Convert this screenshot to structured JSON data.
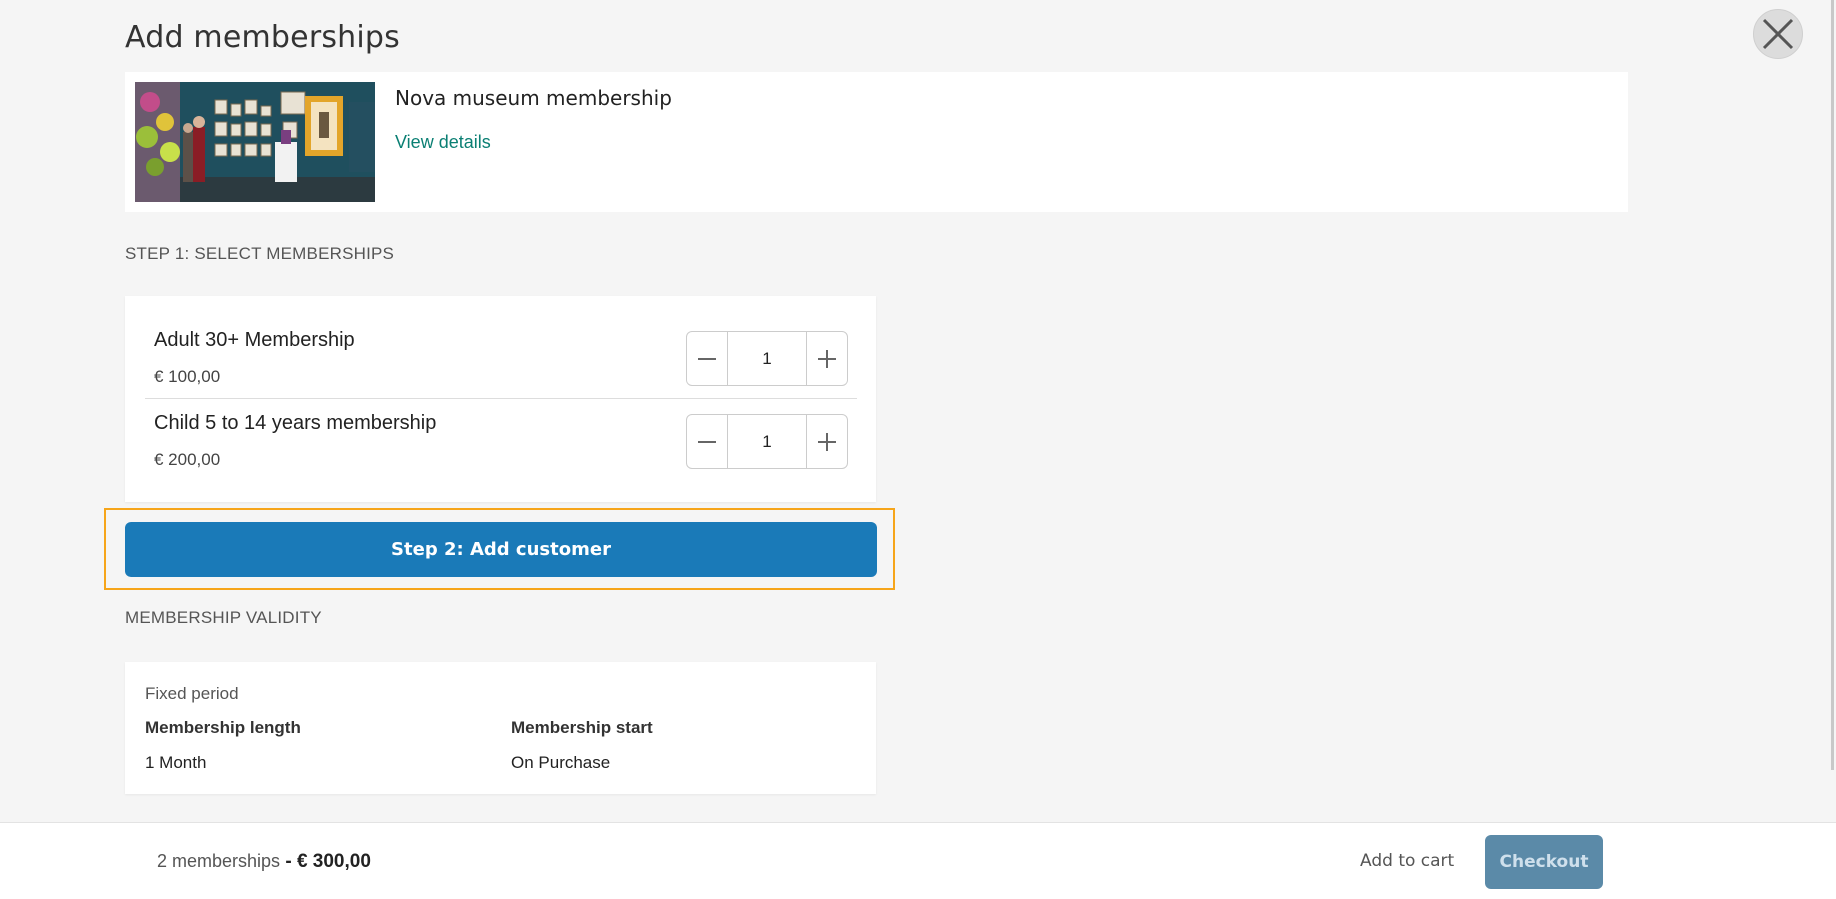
{
  "modal": {
    "title": "Add memberships",
    "close_icon": "close-icon"
  },
  "product": {
    "name": "Nova museum membership",
    "view_details_label": "View details",
    "image": "museum-gallery-photo"
  },
  "step1": {
    "label": "STEP 1: SELECT MEMBERSHIPS",
    "items": [
      {
        "name": "Adult 30+ Membership",
        "price": "€ 100,00",
        "quantity": "1"
      },
      {
        "name": "Child 5 to 14 years membership",
        "price": "€ 200,00",
        "quantity": "1"
      }
    ],
    "minus_icon": "minus-icon",
    "plus_icon": "plus-icon"
  },
  "step2": {
    "button_label": "Step 2: Add customer",
    "highlight_color": "#f6a51a"
  },
  "validity": {
    "label": "MEMBERSHIP VALIDITY",
    "type": "Fixed period",
    "length_label": "Membership length",
    "length_value": "1 Month",
    "start_label": "Membership start",
    "start_value": "On Purchase"
  },
  "footer": {
    "count_text": "2 memberships",
    "separator": " - ",
    "total": "€ 300,00",
    "add_to_cart_label": "Add to cart",
    "checkout_label": "Checkout"
  },
  "colors": {
    "primary": "#1a7ab8",
    "link": "#0a7f73",
    "checkout": "#5b8aa8"
  }
}
